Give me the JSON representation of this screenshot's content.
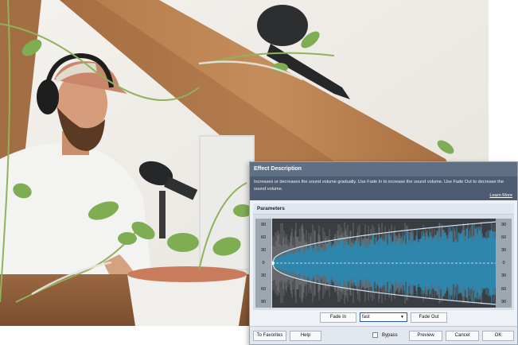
{
  "dialog": {
    "section_title": "Effect Description",
    "description": "Increases or decreases the sound volume gradually. Use Fade In to increase the sound volume. Use Fade Out to decrease the sound volume.",
    "learn_more": "Learn More",
    "params_title": "Parameters",
    "scale_ticks": [
      "90",
      "60",
      "30",
      "0",
      "30",
      "60",
      "90"
    ],
    "fade_in_label": "Fade In",
    "fade_type_value": "fast",
    "fade_out_label": "Fade Out",
    "to_favorites_label": "To Favorites",
    "help_label": "Help",
    "bypass_label": "Bypass",
    "bypass_checked": false,
    "preview_label": "Preview",
    "cancel_label": "Cancel",
    "ok_label": "OK"
  },
  "colors": {
    "header_bar": "#5f6f84",
    "desc_bg": "#4d5c70",
    "waveform": "#2e86ad",
    "waveform_dim": "#6a6c70",
    "envelope": "#cfe3f2"
  }
}
